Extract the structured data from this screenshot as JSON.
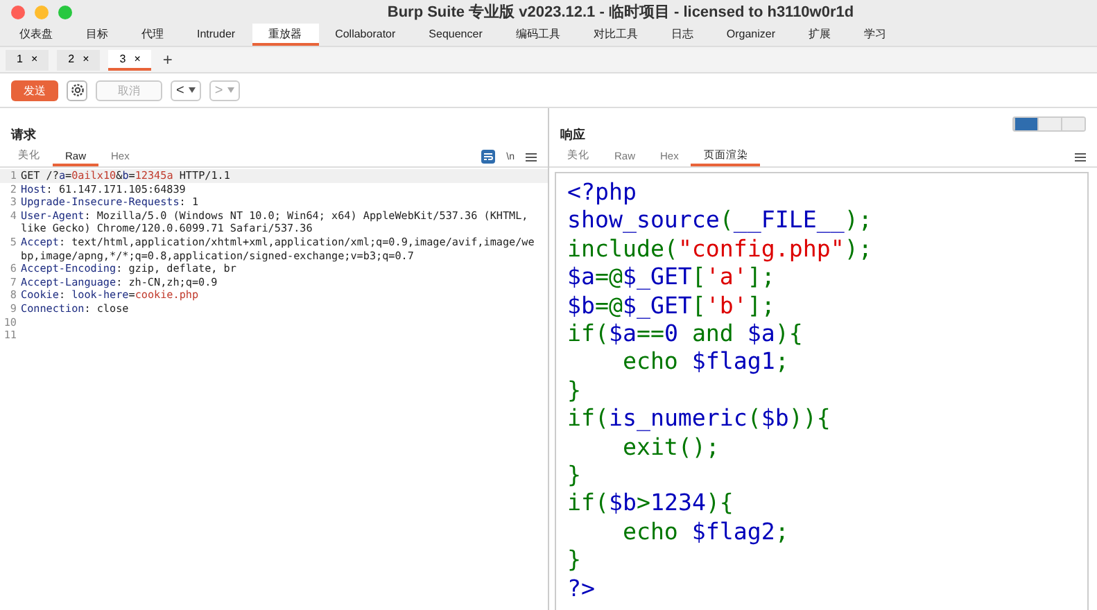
{
  "window": {
    "title": "Burp Suite 专业版  v2023.12.1 - 临时项目 - licensed to h3110w0r1d"
  },
  "main_tabs": [
    {
      "label": "仪表盘",
      "selected": false
    },
    {
      "label": "目标",
      "selected": false
    },
    {
      "label": "代理",
      "selected": false
    },
    {
      "label": "Intruder",
      "selected": false
    },
    {
      "label": "重放器",
      "selected": true
    },
    {
      "label": "Collaborator",
      "selected": false
    },
    {
      "label": "Sequencer",
      "selected": false
    },
    {
      "label": "编码工具",
      "selected": false
    },
    {
      "label": "对比工具",
      "selected": false
    },
    {
      "label": "日志",
      "selected": false
    },
    {
      "label": "Organizer",
      "selected": false
    },
    {
      "label": "扩展",
      "selected": false
    },
    {
      "label": "学习",
      "selected": false
    }
  ],
  "sub_tabs": [
    {
      "label": "1",
      "close": "×",
      "selected": false
    },
    {
      "label": "2",
      "close": "×",
      "selected": false
    },
    {
      "label": "3",
      "close": "×",
      "selected": true
    }
  ],
  "add_tab": "+",
  "toolbar": {
    "send": "发送",
    "cancel": "取消",
    "back": "<",
    "forward": ">"
  },
  "request": {
    "title": "请求",
    "tabs": [
      {
        "label": "美化",
        "selected": false
      },
      {
        "label": "Raw",
        "selected": true
      },
      {
        "label": "Hex",
        "selected": false
      }
    ],
    "actions": [
      "\\n"
    ],
    "lines": [
      {
        "num": "1",
        "highlight": true,
        "segs": [
          {
            "kind": "plain",
            "text": "GET /?"
          },
          {
            "kind": "name",
            "text": "a"
          },
          {
            "kind": "plain",
            "text": "="
          },
          {
            "kind": "value",
            "text": "0ailx10"
          },
          {
            "kind": "plain",
            "text": "&"
          },
          {
            "kind": "name",
            "text": "b"
          },
          {
            "kind": "plain",
            "text": "="
          },
          {
            "kind": "value",
            "text": "12345a"
          },
          {
            "kind": "plain",
            "text": " HTTP/1.1"
          }
        ]
      },
      {
        "num": "2",
        "highlight": false,
        "segs": [
          {
            "kind": "name",
            "text": "Host"
          },
          {
            "kind": "plain",
            "text": ": 61.147.171.105:64839"
          }
        ]
      },
      {
        "num": "3",
        "highlight": false,
        "segs": [
          {
            "kind": "name",
            "text": "Upgrade-Insecure-Requests"
          },
          {
            "kind": "plain",
            "text": ": 1"
          }
        ]
      },
      {
        "num": "4",
        "highlight": false,
        "segs": [
          {
            "kind": "name",
            "text": "User-Agent"
          },
          {
            "kind": "plain",
            "text": ": Mozilla/5.0 (Windows NT 10.0; Win64; x64) AppleWebKit/537.36 (KHTML, like Gecko) Chrome/120.0.6099.71 Safari/537.36"
          }
        ]
      },
      {
        "num": "5",
        "highlight": false,
        "segs": [
          {
            "kind": "name",
            "text": "Accept"
          },
          {
            "kind": "plain",
            "text": ": text/html,application/xhtml+xml,application/xml;q=0.9,image/avif,image/webp,image/apng,*/*;q=0.8,application/signed-exchange;v=b3;q=0.7"
          }
        ]
      },
      {
        "num": "6",
        "highlight": false,
        "segs": [
          {
            "kind": "name",
            "text": "Accept-Encoding"
          },
          {
            "kind": "plain",
            "text": ": gzip, deflate, br"
          }
        ]
      },
      {
        "num": "7",
        "highlight": false,
        "segs": [
          {
            "kind": "name",
            "text": "Accept-Language"
          },
          {
            "kind": "plain",
            "text": ": zh-CN,zh;q=0.9"
          }
        ]
      },
      {
        "num": "8",
        "highlight": false,
        "segs": [
          {
            "kind": "name",
            "text": "Cookie"
          },
          {
            "kind": "plain",
            "text": ": "
          },
          {
            "kind": "name",
            "text": "look-here"
          },
          {
            "kind": "plain",
            "text": "="
          },
          {
            "kind": "value",
            "text": "cookie.php"
          }
        ]
      },
      {
        "num": "9",
        "highlight": false,
        "segs": [
          {
            "kind": "name",
            "text": "Connection"
          },
          {
            "kind": "plain",
            "text": ": close"
          }
        ]
      },
      {
        "num": "10",
        "highlight": false
      },
      {
        "num": "11",
        "highlight": false
      }
    ]
  },
  "response": {
    "title": "响应",
    "tabs": [
      {
        "label": "美化",
        "selected": false
      },
      {
        "label": "Raw",
        "selected": false
      },
      {
        "label": "Hex",
        "selected": false
      },
      {
        "label": "页面渲染",
        "selected": true
      }
    ],
    "source": [
      [
        {
          "kind": "default",
          "text": "<?php"
        }
      ],
      [
        {
          "kind": "default",
          "text": "show_source"
        },
        {
          "kind": "keyword",
          "text": "("
        },
        {
          "kind": "default",
          "text": "__FILE__"
        },
        {
          "kind": "keyword",
          "text": ");"
        }
      ],
      [
        {
          "kind": "keyword",
          "text": "include("
        },
        {
          "kind": "string",
          "text": "\"config.php\""
        },
        {
          "kind": "keyword",
          "text": ");"
        }
      ],
      [
        {
          "kind": "default",
          "text": "$a"
        },
        {
          "kind": "keyword",
          "text": "=@"
        },
        {
          "kind": "default",
          "text": "$_GET"
        },
        {
          "kind": "keyword",
          "text": "["
        },
        {
          "kind": "string",
          "text": "'a'"
        },
        {
          "kind": "keyword",
          "text": "];"
        }
      ],
      [
        {
          "kind": "default",
          "text": "$b"
        },
        {
          "kind": "keyword",
          "text": "=@"
        },
        {
          "kind": "default",
          "text": "$_GET"
        },
        {
          "kind": "keyword",
          "text": "["
        },
        {
          "kind": "string",
          "text": "'b'"
        },
        {
          "kind": "keyword",
          "text": "];"
        }
      ],
      [
        {
          "kind": "keyword",
          "text": "if("
        },
        {
          "kind": "default",
          "text": "$a"
        },
        {
          "kind": "keyword",
          "text": "=="
        },
        {
          "kind": "default",
          "text": "0"
        },
        {
          "kind": "keyword",
          "text": " and "
        },
        {
          "kind": "default",
          "text": "$a"
        },
        {
          "kind": "keyword",
          "text": "){"
        }
      ],
      [
        {
          "kind": "keyword",
          "text": "    echo "
        },
        {
          "kind": "default",
          "text": "$flag1"
        },
        {
          "kind": "keyword",
          "text": ";"
        }
      ],
      [
        {
          "kind": "keyword",
          "text": "}"
        }
      ],
      [
        {
          "kind": "keyword",
          "text": "if("
        },
        {
          "kind": "default",
          "text": "is_numeric"
        },
        {
          "kind": "keyword",
          "text": "("
        },
        {
          "kind": "default",
          "text": "$b"
        },
        {
          "kind": "keyword",
          "text": ")){"
        }
      ],
      [
        {
          "kind": "keyword",
          "text": "    exit();"
        }
      ],
      [
        {
          "kind": "keyword",
          "text": "}"
        }
      ],
      [
        {
          "kind": "keyword",
          "text": "if("
        },
        {
          "kind": "default",
          "text": "$b"
        },
        {
          "kind": "keyword",
          "text": ">"
        },
        {
          "kind": "default",
          "text": "1234"
        },
        {
          "kind": "keyword",
          "text": "){"
        }
      ],
      [
        {
          "kind": "keyword",
          "text": "    echo "
        },
        {
          "kind": "default",
          "text": "$flag2"
        },
        {
          "kind": "keyword",
          "text": ";"
        }
      ],
      [
        {
          "kind": "keyword",
          "text": "}"
        }
      ],
      [
        {
          "kind": "default",
          "text": "?>"
        }
      ]
    ]
  }
}
